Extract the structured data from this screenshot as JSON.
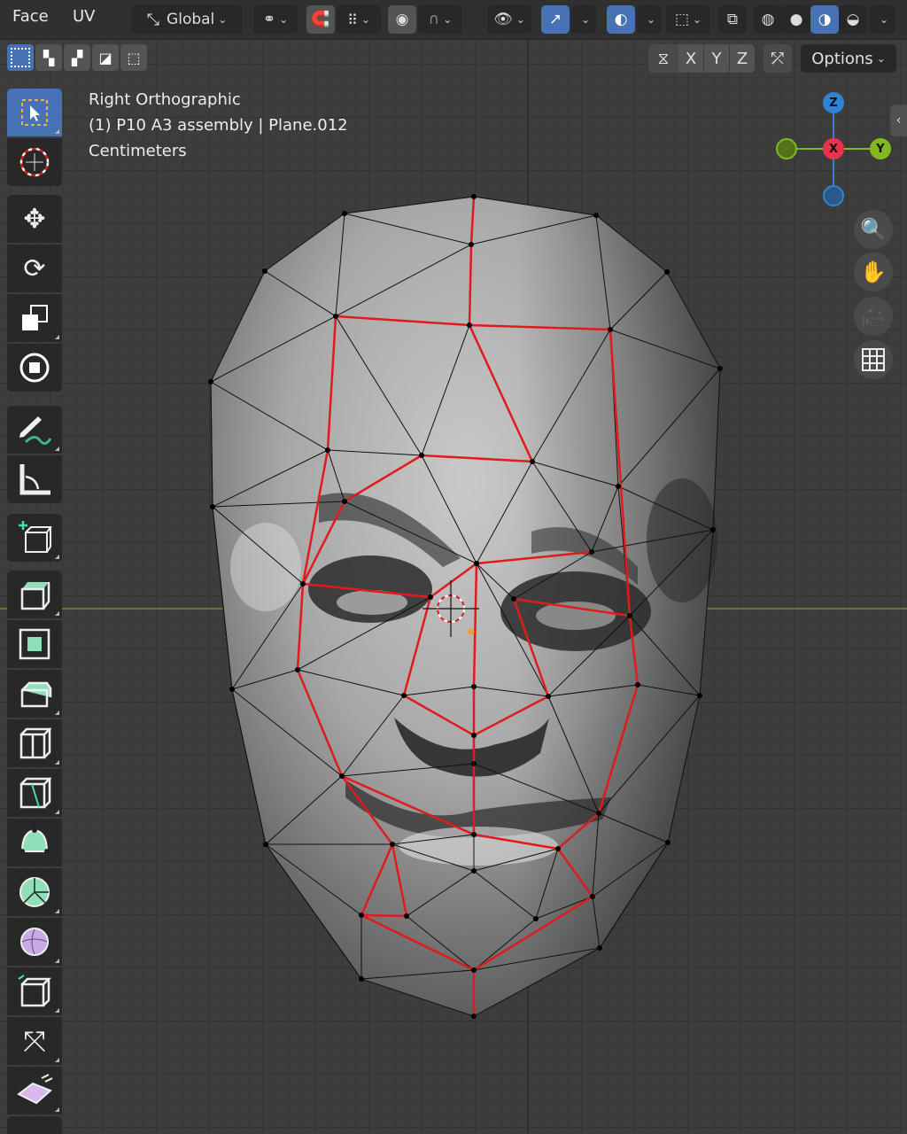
{
  "header": {
    "menu_face": "Face",
    "menu_uv": "UV",
    "orientation_label": "Global",
    "options_label": "Options",
    "axis_x": "X",
    "axis_y": "Y",
    "axis_z": "Z"
  },
  "viewport": {
    "view_name": "Right Orthographic",
    "object_info": "(1) P10 A3 assembly | Plane.012",
    "units": "Centimeters"
  },
  "gizmo": {
    "z": "Z",
    "x": "X",
    "y": "Y"
  },
  "colors": {
    "accent": "#4772b3",
    "seam": "#e01b1b",
    "axis_x": "#e9334c",
    "axis_y": "#84b820",
    "axis_z": "#2f82d6",
    "header_bg": "#303030",
    "viewport_bg": "#3d3d3d"
  },
  "tools": [
    "select-box-icon",
    "cursor-icon",
    "move-icon",
    "rotate-icon",
    "scale-icon",
    "transform-icon",
    "annotate-icon",
    "measure-icon",
    "add-cube-icon",
    "extrude-region-icon",
    "inset-faces-icon",
    "bevel-icon",
    "loop-cut-icon",
    "knife-icon",
    "poly-build-icon",
    "spin-icon",
    "smooth-icon",
    "edge-slide-icon",
    "shrink-fatten-icon",
    "shear-icon"
  ]
}
